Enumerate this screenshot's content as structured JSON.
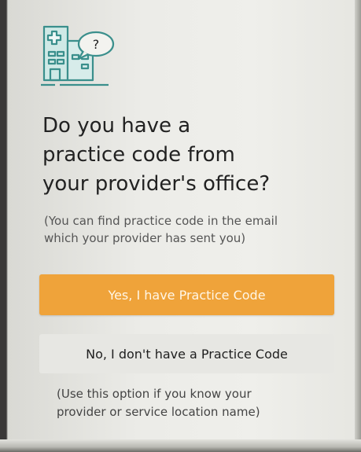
{
  "logo": {
    "icon": "hospital-question-icon",
    "bubble_text": "?",
    "color": "#3a8f8c"
  },
  "question": {
    "lines": [
      "Do you have a",
      "practice code from",
      "your provider's office?"
    ]
  },
  "hint": {
    "lines": [
      "(You can find practice code in the email",
      "which your provider has sent you)"
    ]
  },
  "buttons": {
    "yes_label": "Yes, I have Practice Code",
    "no_label": "No, I don't have a Practice Code",
    "yes_color": "#efa33a",
    "no_color": "#e7e7e3"
  },
  "note": {
    "lines": [
      "(Use this option if you know your",
      "provider or service location name)"
    ]
  }
}
